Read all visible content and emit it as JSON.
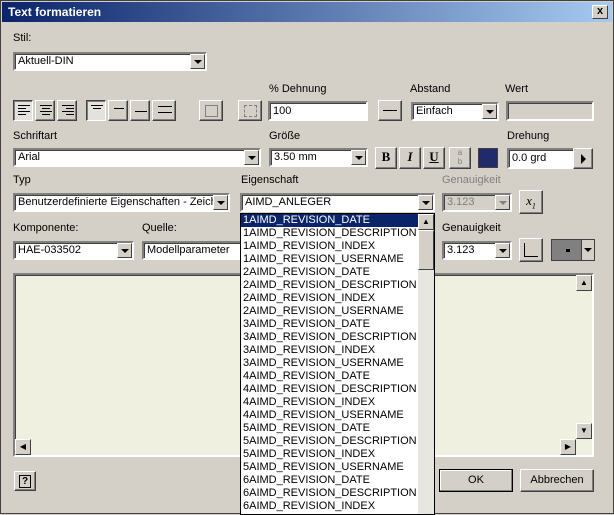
{
  "window": {
    "title": "Text formatieren",
    "close": "x"
  },
  "stil": {
    "label": "Stil:",
    "value": "Aktuell-DIN"
  },
  "dehnung": {
    "label": "% Dehnung",
    "value": "100"
  },
  "abstand": {
    "label": "Abstand",
    "value": "Einfach"
  },
  "wert": {
    "label": "Wert",
    "value": ""
  },
  "schriftart": {
    "label": "Schriftart",
    "value": "Arial"
  },
  "groesse": {
    "label": "Größe",
    "value": "3.50 mm"
  },
  "format_buttons": {
    "bold": "B",
    "italic": "I",
    "underline": "U"
  },
  "drehung": {
    "label": "Drehung",
    "value": "0.0 grd"
  },
  "typ": {
    "label": "Typ",
    "value": "Benutzerdefinierte Eigenschaften - Zeichnung"
  },
  "eigenschaft": {
    "label": "Eigenschaft",
    "value": "AIMD_ANLEGER",
    "options": [
      "1AIMD_REVISION_DATE",
      "1AIMD_REVISION_DESCRIPTION",
      "1AIMD_REVISION_INDEX",
      "1AIMD_REVISION_USERNAME",
      "2AIMD_REVISION_DATE",
      "2AIMD_REVISION_DESCRIPTION",
      "2AIMD_REVISION_INDEX",
      "2AIMD_REVISION_USERNAME",
      "3AIMD_REVISION_DATE",
      "3AIMD_REVISION_DESCRIPTION",
      "3AIMD_REVISION_INDEX",
      "3AIMD_REVISION_USERNAME",
      "4AIMD_REVISION_DATE",
      "4AIMD_REVISION_DESCRIPTION",
      "4AIMD_REVISION_INDEX",
      "4AIMD_REVISION_USERNAME",
      "5AIMD_REVISION_DATE",
      "5AIMD_REVISION_DESCRIPTION",
      "5AIMD_REVISION_INDEX",
      "5AIMD_REVISION_USERNAME",
      "6AIMD_REVISION_DATE",
      "6AIMD_REVISION_DESCRIPTION",
      "6AIMD_REVISION_INDEX"
    ],
    "selected_index": 0
  },
  "genauigkeit1": {
    "label": "Genauigkeit",
    "value": "3.123"
  },
  "komponente": {
    "label": "Komponente:",
    "value": "HAE-033502"
  },
  "quelle": {
    "label": "Quelle:",
    "value": "Modellparameter"
  },
  "genauigkeit2": {
    "label": "Genauigkeit",
    "value": "3.123"
  },
  "buttons": {
    "help": "?",
    "ok": "OK",
    "cancel": "Abbrechen"
  },
  "colors": {
    "text_color": "#222b6a",
    "selection": "#0a246a",
    "textarea_bg": "#f0f0e0"
  }
}
